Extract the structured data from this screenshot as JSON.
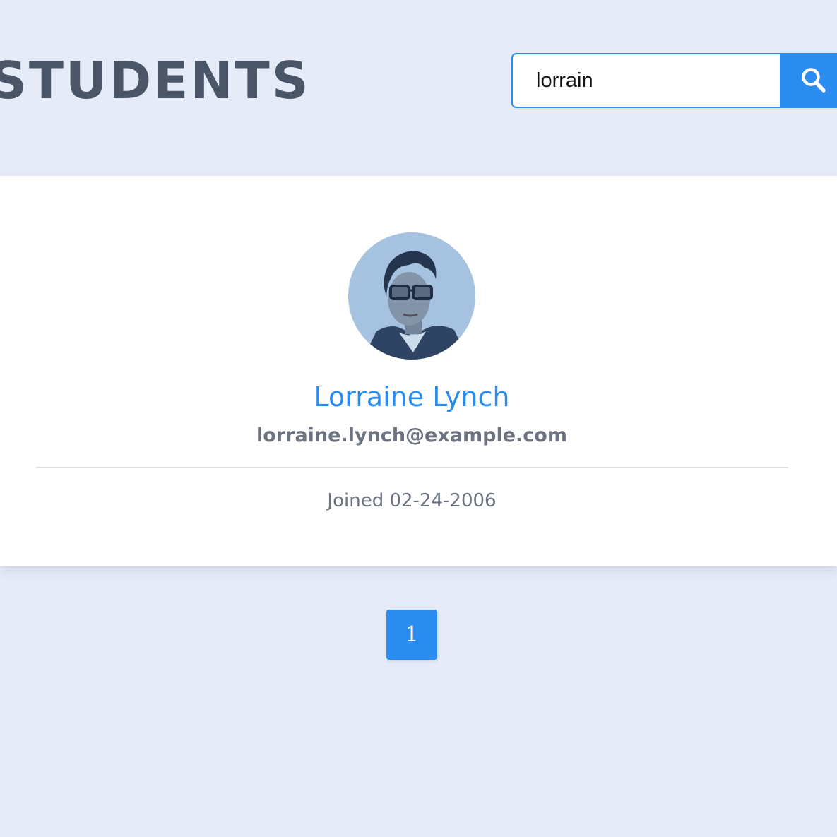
{
  "header": {
    "title": "STUDENTS"
  },
  "search": {
    "value": "lorrain",
    "button_icon": "search-icon"
  },
  "student": {
    "name": "Lorraine Lynch",
    "email": "lorraine.lynch@example.com",
    "joined": "Joined 02-24-2006",
    "avatar": "avatar-photo"
  },
  "pagination": {
    "pages": [
      "1"
    ],
    "current": "1"
  },
  "colors": {
    "background": "#e5ecf8",
    "accent": "#2b8cf0",
    "title": "#4a5568",
    "muted_text": "#6b7280"
  }
}
